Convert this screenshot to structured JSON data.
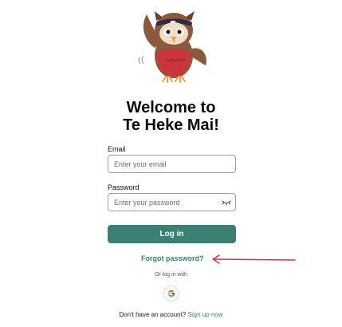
{
  "heading": {
    "line1": "Welcome to",
    "line2": "Te Heke Mai!"
  },
  "mascot": {
    "icon": "owl-mascot-icon"
  },
  "email": {
    "label": "Email",
    "placeholder": "Enter your email",
    "value": ""
  },
  "password": {
    "label": "Password",
    "placeholder": "Enter your password",
    "value": "",
    "toggle_icon": "eye-closed-icon"
  },
  "login_button": {
    "label": "Log in",
    "color": "#3b7f72"
  },
  "forgot_password": {
    "label": "Forgot password?"
  },
  "annotation": {
    "icon": "red-arrow-icon",
    "color": "#d9343f"
  },
  "social": {
    "or_text": "Or log in with",
    "google_icon": "google-g-icon"
  },
  "signup": {
    "prompt": "Don't have an account?",
    "link": "Sign up now"
  },
  "colors": {
    "accent": "#3b7f72",
    "heading": "#0a0a0a",
    "border": "#9c9c9c"
  }
}
